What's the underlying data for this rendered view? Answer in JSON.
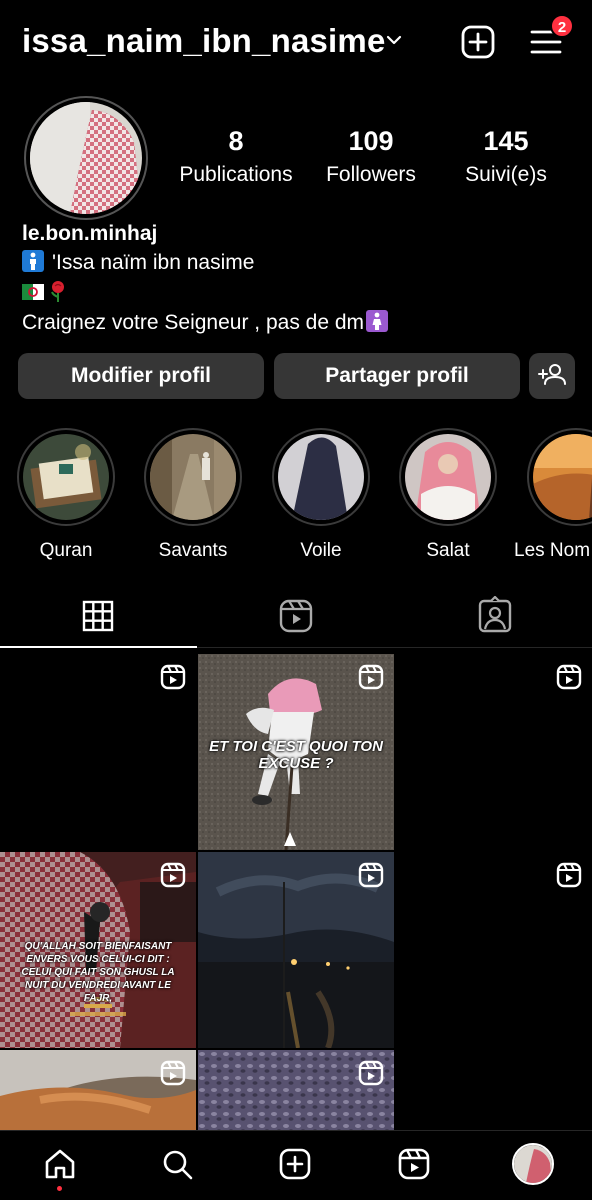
{
  "header": {
    "username": "issa_naim_ibn_nasime",
    "notification_count": "2",
    "icons": [
      "chevron-down-icon",
      "new-post-icon",
      "menu-icon"
    ]
  },
  "profile": {
    "stats": [
      {
        "value": "8",
        "label": "Publications"
      },
      {
        "value": "109",
        "label": "Followers"
      },
      {
        "value": "145",
        "label": "Suivi(e)s"
      }
    ],
    "handle": "le.bon.minhaj",
    "bio_name": "'Issa naïm ibn nasime",
    "bio_quote": "Craignez votre Seigneur , pas de dm"
  },
  "buttons": {
    "edit_profile": "Modifier profil",
    "share_profile": "Partager profil"
  },
  "highlights": [
    {
      "label": "Quran"
    },
    {
      "label": "Savants"
    },
    {
      "label": "Voile"
    },
    {
      "label": "Salat"
    },
    {
      "label": "Les Nom"
    }
  ],
  "tabs": [
    "grid-icon",
    "reels-tab-icon",
    "tagged-icon"
  ],
  "posts": {
    "post_2_text": "ET TOI C'EST QUOI TON EXCUSE ?",
    "post_4_text": "QU'ALLAH SOIT BIENFAISANT ENVERS VOUS CELUI-CI DIT : CELUI QUI FAIT SON GHUSL LA NUIT DU VENDREDI AVANT LE FAJR,"
  },
  "nav": [
    "home-icon",
    "search-icon",
    "create-icon",
    "reels-icon",
    "profile-avatar"
  ],
  "colors": {
    "background": "#000000",
    "button": "#363636",
    "badge": "#ff3040"
  }
}
